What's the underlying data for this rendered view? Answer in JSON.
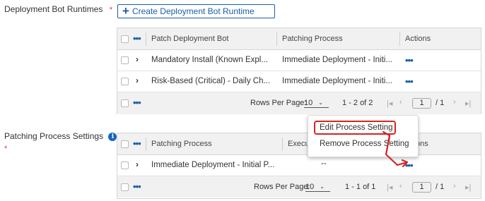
{
  "runtimes": {
    "label": "Deployment Bot Runtimes",
    "required_mark": "*",
    "create_button_label": "Create Deployment Bot Runtime",
    "table": {
      "columns": [
        "Patch Deployment Bot",
        "Patching Process",
        "Actions"
      ],
      "rows": [
        {
          "bot": "Mandatory Install (Known Expl...",
          "process": "Immediate Deployment - Initi..."
        },
        {
          "bot": "Risk-Based (Critical) - Daily Ch...",
          "process": "Immediate Deployment - Initi..."
        }
      ],
      "footer": {
        "rows_per_page_label": "Rows Per Page:",
        "rows_per_page_value": "10",
        "range": "1 - 2 of 2",
        "page": "1",
        "total_pages": "/ 1"
      }
    }
  },
  "process_settings": {
    "label": "Patching Process Settings",
    "required_mark": "*",
    "info_glyph": "i",
    "table": {
      "columns": [
        "Patching Process",
        "Execu",
        "ons"
      ],
      "rows": [
        {
          "process": "Immediate Deployment - Initial P...",
          "execution": "--"
        }
      ],
      "footer": {
        "rows_per_page_label": "Rows Per Page:",
        "rows_per_page_value": "10",
        "range": "1 - 1 of 1",
        "page": "1",
        "total_pages": "/ 1"
      }
    }
  },
  "context_menu": {
    "items": [
      "Edit Process Setting",
      "Remove Process Setting"
    ],
    "highlighted_index": 0
  },
  "icons": {
    "more": "•••",
    "expand": "›",
    "first": "|◂",
    "prev": "‹",
    "next": "›",
    "last": "▸|",
    "caret": "⌄"
  },
  "colors": {
    "accent": "#1b5fa5",
    "highlight": "#d42424",
    "required": "#d93a3a"
  }
}
